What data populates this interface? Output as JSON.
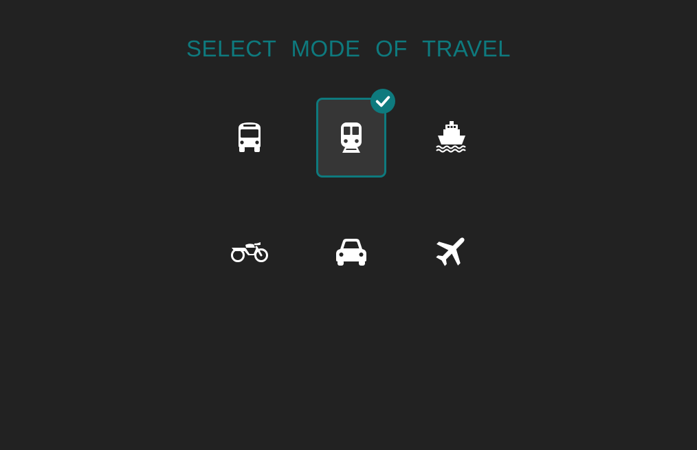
{
  "page": {
    "title": "SELECT MODE OF TRAVEL",
    "accent_color": "#0e7a7e",
    "background_color": "#222222"
  },
  "modes": [
    {
      "id": "bus",
      "icon": "bus-icon",
      "selected": false
    },
    {
      "id": "train",
      "icon": "train-icon",
      "selected": true
    },
    {
      "id": "ship",
      "icon": "ship-icon",
      "selected": false
    },
    {
      "id": "motorcycle",
      "icon": "motorcycle-icon",
      "selected": false
    },
    {
      "id": "car",
      "icon": "car-icon",
      "selected": false
    },
    {
      "id": "plane",
      "icon": "plane-icon",
      "selected": false
    }
  ],
  "selection_indicator": {
    "icon": "checkmark-icon"
  }
}
